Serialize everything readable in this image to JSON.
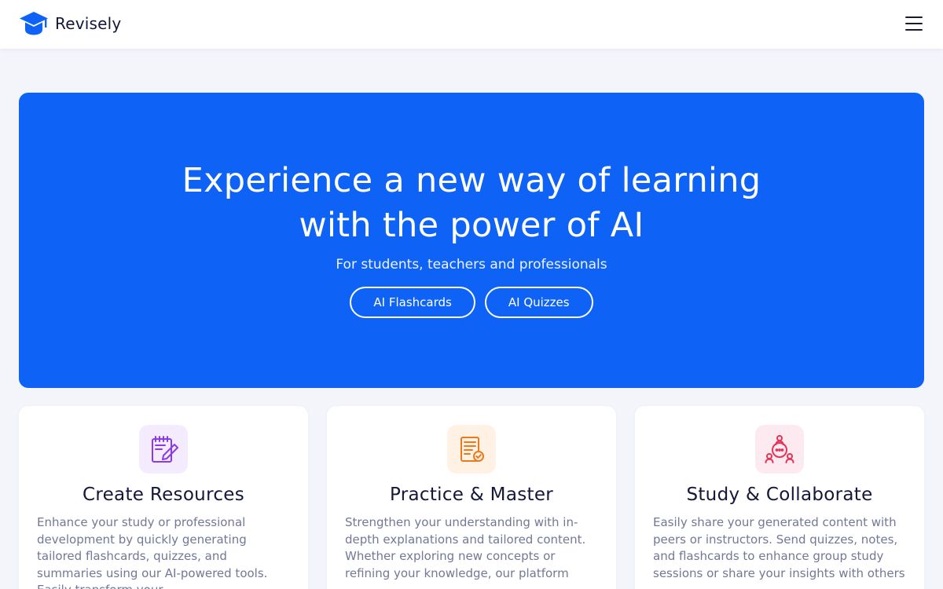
{
  "header": {
    "brand_name": "Revisely",
    "logo_icon": "graduation-cap-icon",
    "menu_icon": "hamburger-menu-icon"
  },
  "hero": {
    "title_line1": "Experience a new way of learning",
    "title_line2": "with the power of AI",
    "subtitle": "For students, teachers and professionals",
    "buttons": [
      "AI Flashcards",
      "AI Quizzes"
    ],
    "background_color": "#0e63f6"
  },
  "features": [
    {
      "icon": "notepad-pencil-icon",
      "icon_color": "#8a3be6",
      "icon_bg": "#f4ecfe",
      "title": "Create Resources",
      "description": "Enhance your study or professional development by quickly generating tailored flashcards, quizzes, and summaries using our AI-powered tools. Easily transform your"
    },
    {
      "icon": "document-check-icon",
      "icon_color": "#ea7a1c",
      "icon_bg": "#fff1e3",
      "title": "Practice & Master",
      "description": "Strengthen your understanding with in-depth explanations and tailored content. Whether exploring new concepts or refining your knowledge, our platform"
    },
    {
      "icon": "collaboration-chat-icon",
      "icon_color": "#e5345a",
      "icon_bg": "#fdeaf0",
      "title": "Study & Collaborate",
      "description": "Easily share your generated content with peers or instructors. Send quizzes, notes, and flashcards to enhance group study sessions or share your insights with others"
    }
  ]
}
